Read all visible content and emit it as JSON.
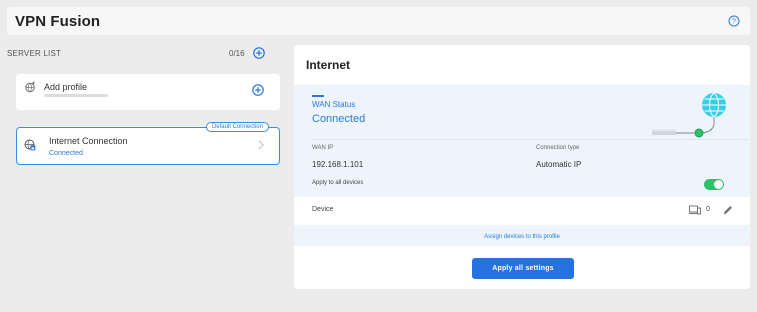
{
  "app": {
    "title": "VPN Fusion"
  },
  "sidebar": {
    "section_label": "SERVER LIST",
    "server_count": "0/16",
    "add_profile": {
      "label": "Add profile"
    },
    "connections": [
      {
        "name": "Internet Connection",
        "status": "Connected",
        "badge": "Default Connection"
      }
    ]
  },
  "panel": {
    "title": "Internet",
    "wan_status_label": "WAN Status",
    "wan_status_value": "Connected",
    "wan_ip_label": "WAN IP",
    "wan_ip_value": "192.168.1.101",
    "connection_type_label": "Connection type",
    "connection_type_value": "Automatic IP",
    "apply_to_all_label": "Apply to all devices",
    "apply_to_all_enabled": true,
    "device_label": "Device",
    "device_count": "0",
    "assign_link": "Assign devices to this profile",
    "apply_button": "Apply all settings"
  },
  "colors": {
    "accent": "#2572e0",
    "link": "#2d7ad6",
    "toggle_on": "#2dc16b",
    "status_bg": "#eef4fb",
    "globe": "#35d0e6"
  },
  "icons": {
    "help": "help-circle-icon",
    "add": "plus-circle-icon",
    "globe": "globe-icon",
    "vpn": "shield-globe-icon",
    "chevron": "chevron-right-icon",
    "device": "device-icon",
    "edit": "pencil-icon"
  }
}
